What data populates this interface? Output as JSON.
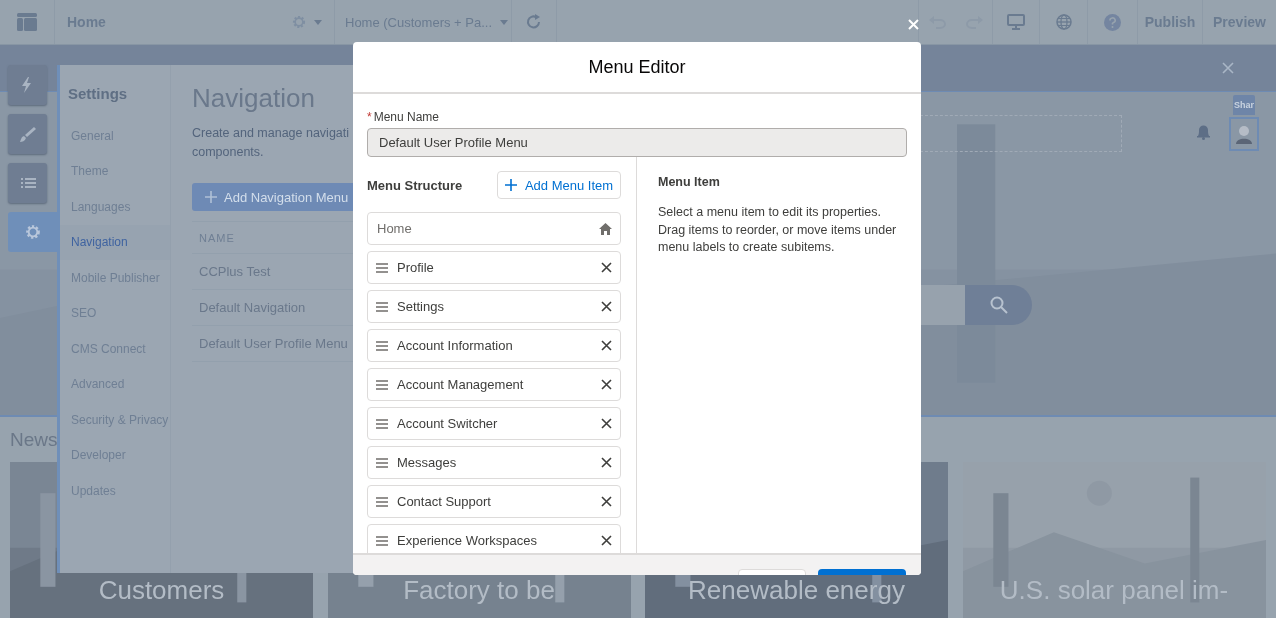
{
  "top_bar": {
    "page": "Home",
    "page_variant": "Home (Customers + Pa...",
    "actions": [
      "Publish",
      "Preview"
    ]
  },
  "rail": [
    {
      "kind": "lightning",
      "selected": false
    },
    {
      "kind": "brush",
      "selected": false
    },
    {
      "kind": "list",
      "selected": false
    },
    {
      "kind": "gear",
      "selected": true
    }
  ],
  "settings": {
    "title": "Settings",
    "items": [
      {
        "label": "General",
        "selected": false
      },
      {
        "label": "Theme",
        "selected": false
      },
      {
        "label": "Languages",
        "selected": false
      },
      {
        "label": "Navigation",
        "selected": true
      },
      {
        "label": "Mobile Publisher",
        "selected": false
      },
      {
        "label": "SEO",
        "selected": false
      },
      {
        "label": "CMS Connect",
        "selected": false
      },
      {
        "label": "Advanced",
        "selected": false
      },
      {
        "label": "Security & Privacy",
        "selected": false
      },
      {
        "label": "Developer",
        "selected": false
      },
      {
        "label": "Updates",
        "selected": false
      }
    ]
  },
  "navigation": {
    "title": "Navigation",
    "description": [
      "Create and manage navigati",
      "components."
    ],
    "add_button": "Add Navigation Menu",
    "table": {
      "columns": [
        "NAME"
      ],
      "rows": [
        "CCPlus Test",
        "Default Navigation",
        "Default User Profile Menu"
      ]
    }
  },
  "site": {
    "share": "Shar",
    "news_title": "News",
    "cards": [
      {
        "title": "Customers"
      },
      {
        "title": "Factory to be"
      },
      {
        "title": "Renewable energy"
      },
      {
        "title": "U.S. solar panel im-"
      }
    ]
  },
  "modal": {
    "title": "Menu Editor",
    "menu_name": {
      "required_mark": "*",
      "label": "Menu Name",
      "value": "Default User Profile Menu"
    },
    "structure_title": "Menu Structure",
    "add_item": "Add Menu Item",
    "items": [
      {
        "label": "Home",
        "kind": "home"
      },
      {
        "label": "Profile",
        "kind": "item"
      },
      {
        "label": "Settings",
        "kind": "item"
      },
      {
        "label": "Account Information",
        "kind": "item"
      },
      {
        "label": "Account Management",
        "kind": "item"
      },
      {
        "label": "Account Switcher",
        "kind": "item"
      },
      {
        "label": "Messages",
        "kind": "item"
      },
      {
        "label": "Contact Support",
        "kind": "item"
      },
      {
        "label": "Experience Workspaces",
        "kind": "item"
      }
    ],
    "detail_title": "Menu Item",
    "detail_text": "Select a menu item to edit its properties. Drag items to reorder, or move items under menu labels to create subitems."
  }
}
